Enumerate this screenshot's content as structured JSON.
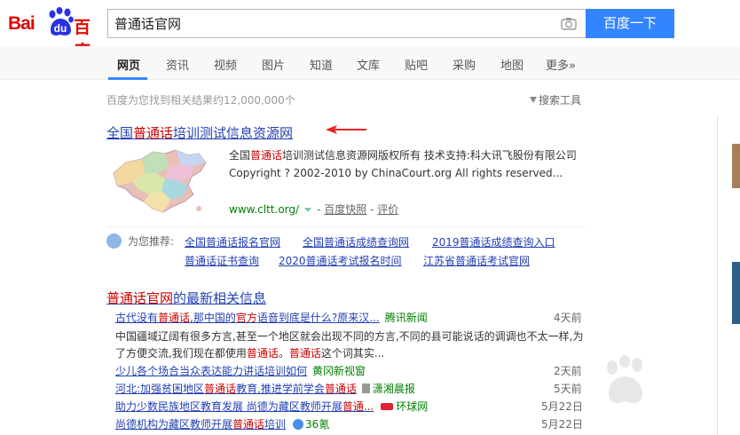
{
  "header": {
    "logo": {
      "part1": "Bai",
      "part2": "du",
      "part3": "百度"
    },
    "search_value": "普通话官网",
    "search_button": "百度一下"
  },
  "nav": {
    "tabs": [
      "网页",
      "资讯",
      "视频",
      "图片",
      "知道",
      "文库",
      "贴吧",
      "采购",
      "地图",
      "更多»"
    ]
  },
  "stats": {
    "count_text": "百度为您找到相关结果约12,000,000个",
    "tools_label": "搜索工具"
  },
  "result1": {
    "title_pre": "全国",
    "title_em": "普通话",
    "title_post": "培训测试信息资源网",
    "abstract_pre": "全国",
    "abstract_em": "普通话",
    "abstract_post": "培训测试信息资源网版权所有 技术支持:科大讯飞股份有限公司 Copyright ? 2002-2010 by ChinaCourt.org All rights reserved...",
    "url": "www.cltt.org/",
    "snapshot": "百度快照",
    "dash": "-",
    "review": "评价"
  },
  "recommend": {
    "label": "为您推荐:",
    "links": [
      "全国普通话报名官网",
      "全国普通话成绩查询网",
      "2019普通话成绩查询入口",
      "普通话证书查询",
      "2020普通话考试报名时间",
      "江苏省普通话考试官网"
    ]
  },
  "news": {
    "title_em": "普通话官网",
    "title_post": "的最新相关信息",
    "items": [
      {
        "pre": "古代没有",
        "em": "普通话",
        "mid": ",那中国的",
        "em2": "官方",
        "post": "语音到底是什么?原来汉...",
        "source": "腾讯新闻",
        "time": "4天前"
      },
      {
        "pre": "少儿各个场合当众表达能力讲话培训如何",
        "source": "黄冈新视窗",
        "time": "2天前"
      },
      {
        "pre": "河北:加强贫困地区",
        "em": "普通话",
        "mid": "教育,推进学前学会",
        "em2": "普通话",
        "post": "",
        "source": "潇湘晨报",
        "time": "5天前"
      },
      {
        "pre": "助力少数民族地区教育发展 尚德为藏区教师开展",
        "em": "普通...",
        "source": "环球网",
        "time": "5月22日"
      },
      {
        "pre": "尚德机构为藏区教师开展",
        "em": "普通话",
        "post": "培训",
        "source": "36氪",
        "time": "5月22日"
      }
    ],
    "snippet_pre": "中国疆域辽阔有很多方言,甚至一个地区就会出现不同的方言,不同的县可能说话的调调也不太一样,为了方便交流,我们现在都使用",
    "snippet_em1": "普通话",
    "snippet_mid": "。",
    "snippet_em2": "普通话",
    "snippet_post": "这个词其实..."
  },
  "colors": {
    "brand_red": "#e10602",
    "brand_blue": "#3385ff",
    "link": "#2440b3",
    "highlight": "#c00",
    "url_green": "#008000"
  }
}
